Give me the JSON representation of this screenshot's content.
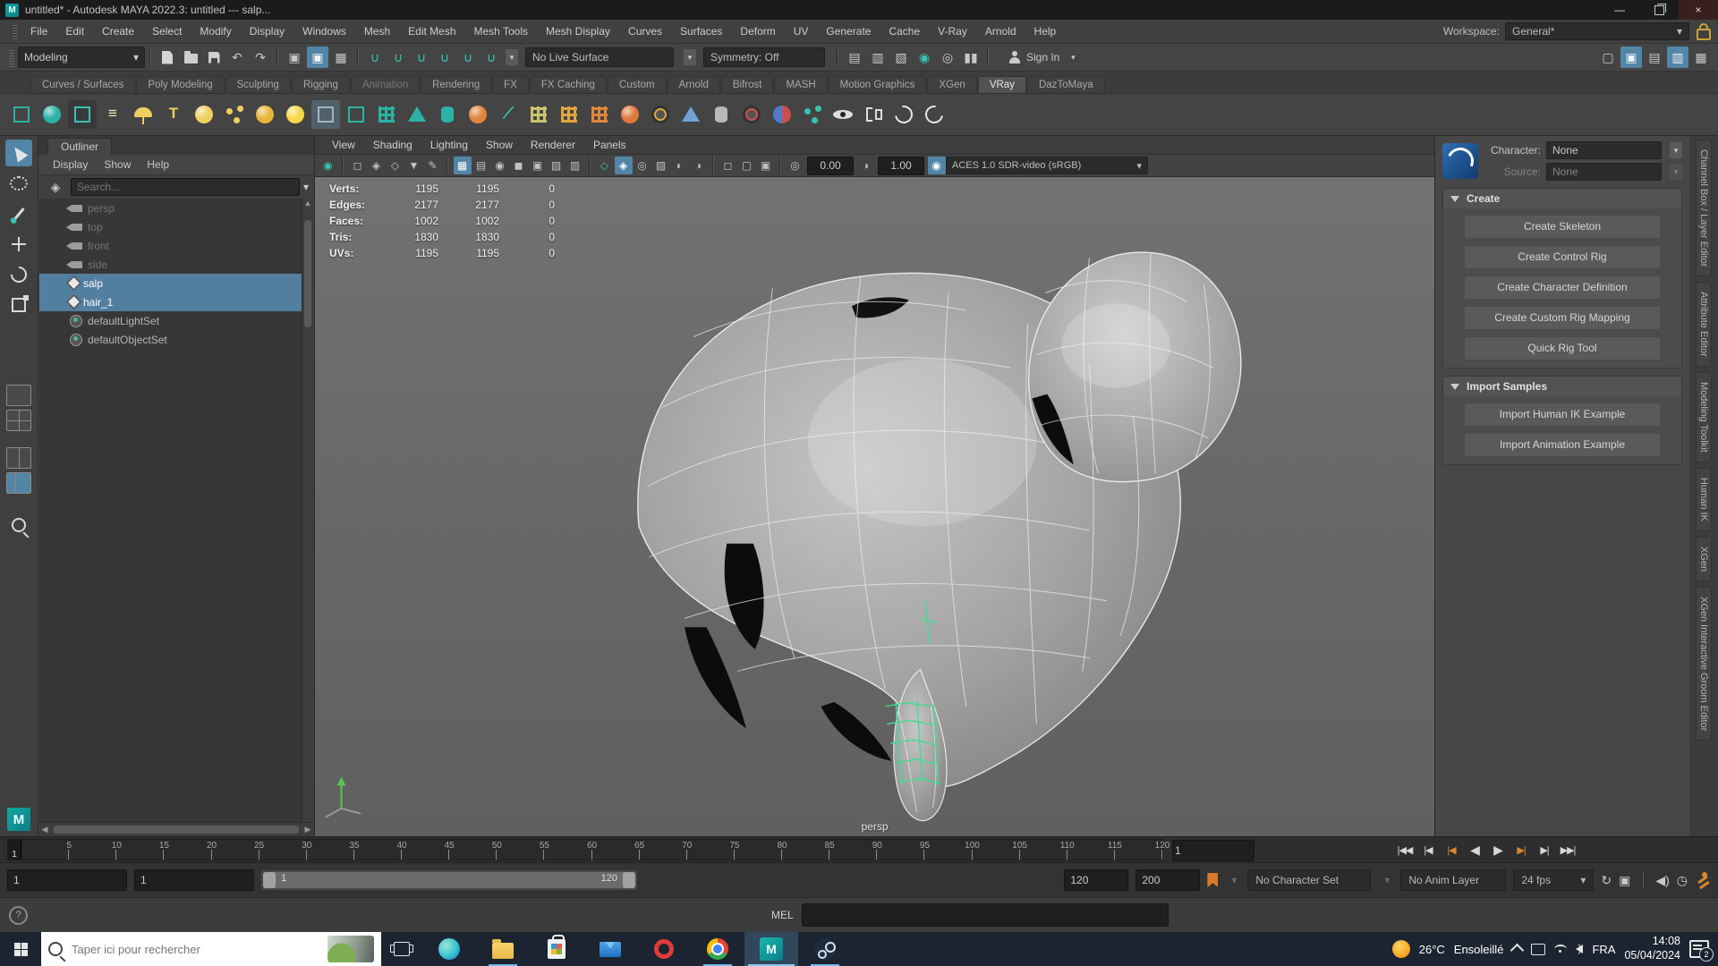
{
  "titlebar": {
    "title": "untitled* - Autodesk MAYA 2022.3: untitled  ---  salp..."
  },
  "menubar": {
    "items": [
      "File",
      "Edit",
      "Create",
      "Select",
      "Modify",
      "Display",
      "Windows",
      "Mesh",
      "Edit Mesh",
      "Mesh Tools",
      "Mesh Display",
      "Curves",
      "Surfaces",
      "Deform",
      "UV",
      "Generate",
      "Cache",
      "V-Ray",
      "Arnold",
      "Help"
    ],
    "workspace_label": "Workspace:",
    "workspace_value": "General*"
  },
  "statusline": {
    "mode": "Modeling",
    "no_live_surface": "No Live Surface",
    "symmetry": "Symmetry: Off",
    "sign_in": "Sign In"
  },
  "shelf": {
    "tabs": [
      "Curves / Surfaces",
      "Poly Modeling",
      "Sculpting",
      "Rigging",
      "Animation",
      "Rendering",
      "FX",
      "FX Caching",
      "Custom",
      "Arnold",
      "Bifrost",
      "MASH",
      "Motion Graphics",
      "XGen",
      "VRay",
      "DazToMaya"
    ]
  },
  "outliner": {
    "tab": "Outliner",
    "menus": [
      "Display",
      "Show",
      "Help"
    ],
    "search_placeholder": "Search...",
    "items": [
      {
        "label": "persp"
      },
      {
        "label": "top"
      },
      {
        "label": "front"
      },
      {
        "label": "side"
      },
      {
        "label": "salp"
      },
      {
        "label": "hair_1"
      },
      {
        "label": "defaultLightSet"
      },
      {
        "label": "defaultObjectSet"
      }
    ]
  },
  "viewport": {
    "menus": [
      "View",
      "Shading",
      "Lighting",
      "Show",
      "Renderer",
      "Panels"
    ],
    "exposure": "0.00",
    "gamma": "1.00",
    "colorspace": "ACES 1.0 SDR-video (sRGB)",
    "camera": "persp",
    "hud": [
      {
        "label": "Verts:",
        "total": "1195",
        "selected": "1195",
        "other": "0"
      },
      {
        "label": "Edges:",
        "total": "2177",
        "selected": "2177",
        "other": "0"
      },
      {
        "label": "Faces:",
        "total": "1002",
        "selected": "1002",
        "other": "0"
      },
      {
        "label": "Tris:",
        "total": "1830",
        "selected": "1830",
        "other": "0"
      },
      {
        "label": "UVs:",
        "total": "1195",
        "selected": "1195",
        "other": "0"
      }
    ]
  },
  "humanik": {
    "character_label": "Character:",
    "character_value": "None",
    "source_label": "Source:",
    "source_value": "None",
    "create_title": "Create",
    "create_buttons": [
      "Create Skeleton",
      "Create Control Rig",
      "Create Character Definition",
      "Create Custom Rig Mapping",
      "Quick Rig Tool"
    ],
    "import_title": "Import Samples",
    "import_buttons": [
      "Import Human IK Example",
      "Import Animation Example"
    ]
  },
  "side_tabs": [
    "Channel Box / Layer Editor",
    "Attribute Editor",
    "Modeling Toolkit",
    "Human IK",
    "XGen",
    "XGen Interactive Groom Editor"
  ],
  "timeline": {
    "current": "1",
    "ticks": [
      "5",
      "10",
      "15",
      "20",
      "25",
      "30",
      "35",
      "40",
      "45",
      "50",
      "55",
      "60",
      "65",
      "70",
      "75",
      "80",
      "85",
      "90",
      "95",
      "100",
      "105",
      "110",
      "115",
      "120"
    ],
    "frame_field": "1",
    "playback": [
      "|◀◀",
      "|◀",
      "|◀",
      "◀",
      "▶",
      "▶|",
      "▶|",
      "▶▶|"
    ]
  },
  "rangebar": {
    "anim_start": "1",
    "play_start": "1",
    "slider_start": "1",
    "slider_end": "120",
    "play_end": "120",
    "anim_end": "200",
    "character_set": "No Character Set",
    "anim_layer": "No Anim Layer",
    "fps": "24 fps"
  },
  "commandline": {
    "label": "MEL"
  },
  "taskbar": {
    "search_placeholder": "Taper ici pour rechercher",
    "temperature": "26°C",
    "weather": "Ensoleillé",
    "language": "FRA",
    "time": "14:08",
    "date": "05/04/2024",
    "notification_count": "2"
  }
}
